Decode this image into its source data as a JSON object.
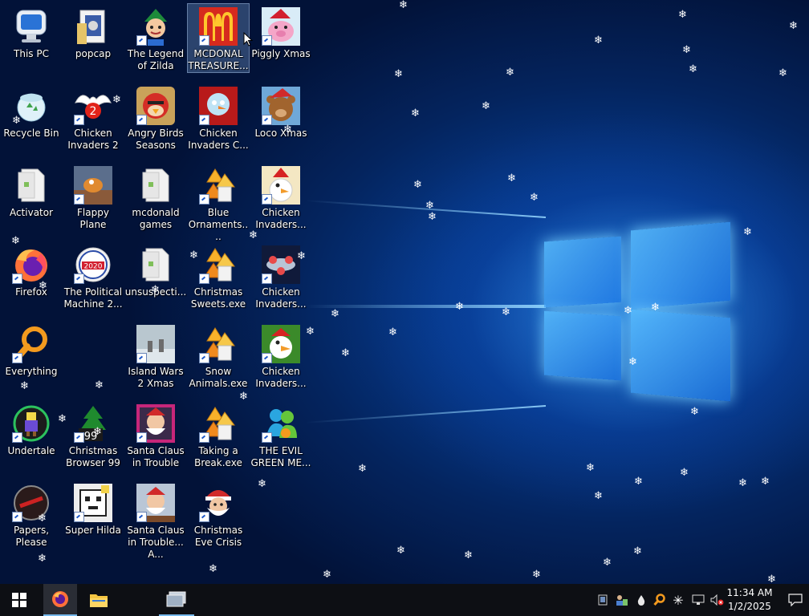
{
  "desktop": {
    "icons": [
      {
        "label": "This PC",
        "name": "icon-this-pc",
        "art": "monitor"
      },
      {
        "label": "popcap",
        "name": "icon-popcap",
        "art": "folder-doc"
      },
      {
        "label": "The Legend of Zilda",
        "name": "icon-legend-of-zilda",
        "art": "elf",
        "shortcut": true
      },
      {
        "label": "MCDONAL TREASURE...",
        "name": "icon-mcdonal-treasure",
        "art": "mcdonalds",
        "shortcut": true,
        "selected": true
      },
      {
        "label": "Piggly Xmas",
        "name": "icon-piggly-xmas",
        "art": "pig",
        "shortcut": true
      },
      {
        "label": "Recycle Bin",
        "name": "icon-recycle-bin",
        "art": "recycle"
      },
      {
        "label": "Chicken Invaders 2",
        "name": "icon-chicken-invaders-2",
        "art": "chicken2",
        "shortcut": true
      },
      {
        "label": "Angry Birds Seasons",
        "name": "icon-angry-birds-seasons",
        "art": "angrybird",
        "shortcut": true
      },
      {
        "label": "Chicken Invaders C...",
        "name": "icon-chicken-invaders-c",
        "art": "snowman",
        "shortcut": true
      },
      {
        "label": "Loco Xmas",
        "name": "icon-loco-xmas",
        "art": "bear",
        "shortcut": true
      },
      {
        "label": "Activator",
        "name": "icon-activator",
        "art": "doc",
        "shortcut": false
      },
      {
        "label": "Flappy Plane",
        "name": "icon-flappy-plane",
        "art": "plane",
        "shortcut": true
      },
      {
        "label": "mcdonald games",
        "name": "icon-mcdonald-games",
        "art": "doc",
        "shortcut": false
      },
      {
        "label": "Blue Ornaments....",
        "name": "icon-blue-ornaments",
        "art": "stars",
        "shortcut": true
      },
      {
        "label": "Chicken Invaders...",
        "name": "icon-chicken-invaders-a",
        "art": "chicken",
        "shortcut": true
      },
      {
        "label": "Firefox",
        "name": "icon-firefox",
        "art": "firefox",
        "shortcut": true
      },
      {
        "label": "The Political Machine 2...",
        "name": "icon-political-machine",
        "art": "political",
        "shortcut": true
      },
      {
        "label": "unsuspecti...",
        "name": "icon-unsuspecti",
        "art": "doc",
        "shortcut": false
      },
      {
        "label": "Christmas Sweets.exe",
        "name": "icon-christmas-sweets",
        "art": "stars",
        "shortcut": true
      },
      {
        "label": "Chicken Invaders...",
        "name": "icon-chicken-invaders-b",
        "art": "ship",
        "shortcut": true
      },
      {
        "label": "Everything",
        "name": "icon-everything",
        "art": "magnifier",
        "shortcut": true
      },
      {
        "label": "Island Wars 2 Xmas",
        "name": "icon-island-wars",
        "art": "island",
        "shortcut": true
      },
      {
        "label": "Snow Animals.exe",
        "name": "icon-snow-animals",
        "art": "stars",
        "shortcut": true
      },
      {
        "label": "Chicken Invaders...",
        "name": "icon-chicken-invaders-c2",
        "art": "chicken3",
        "shortcut": true
      },
      {
        "label": "Undertale",
        "name": "icon-undertale",
        "art": "undertale",
        "shortcut": true
      },
      {
        "label": "Christmas Browser 99",
        "name": "icon-christmas-browser",
        "art": "tree",
        "shortcut": true
      },
      {
        "label": "Santa Claus in Trouble",
        "name": "icon-santa-trouble",
        "art": "santa",
        "shortcut": true
      },
      {
        "label": "Taking a Break.exe",
        "name": "icon-taking-a-break",
        "art": "stars",
        "shortcut": true
      },
      {
        "label": "THE EVIL GREEN ME...",
        "name": "icon-evil-green",
        "art": "messenger",
        "shortcut": true
      },
      {
        "label": "Papers, Please",
        "name": "icon-papers-please",
        "art": "papers",
        "shortcut": true
      },
      {
        "label": "Super Hilda",
        "name": "icon-super-hilda",
        "art": "hilda",
        "shortcut": true
      },
      {
        "label": "Santa Claus in Trouble... A...",
        "name": "icon-santa-trouble-2",
        "art": "santa2",
        "shortcut": true
      },
      {
        "label": "Christmas Eve Crisis",
        "name": "icon-christmas-eve-crisis",
        "art": "santaface",
        "shortcut": true
      }
    ]
  },
  "taskbar": {
    "start_icon": "windows-logo-icon",
    "pinned": [
      {
        "name": "firefox-taskbar-button",
        "icon": "firefox-icon",
        "active": true
      },
      {
        "name": "file-explorer-taskbar-button",
        "icon": "folder-icon",
        "active": false
      },
      {
        "name": "running-app-taskbar-button",
        "icon": "app-window-icon",
        "active": true
      }
    ],
    "tray_icons": [
      "tablet-icon",
      "user-network-icon",
      "droplet-icon",
      "magnifier-icon",
      "snowflake-icon",
      "network-icon",
      "volume-muted-icon"
    ],
    "clock": {
      "time": "11:34 AM",
      "date": "1/2/2025"
    },
    "notification_icon": "notification-icon"
  },
  "colors": {
    "taskbar": "#0d0f14",
    "accent": "#1e90ff",
    "selection": "#7aa0d2"
  }
}
